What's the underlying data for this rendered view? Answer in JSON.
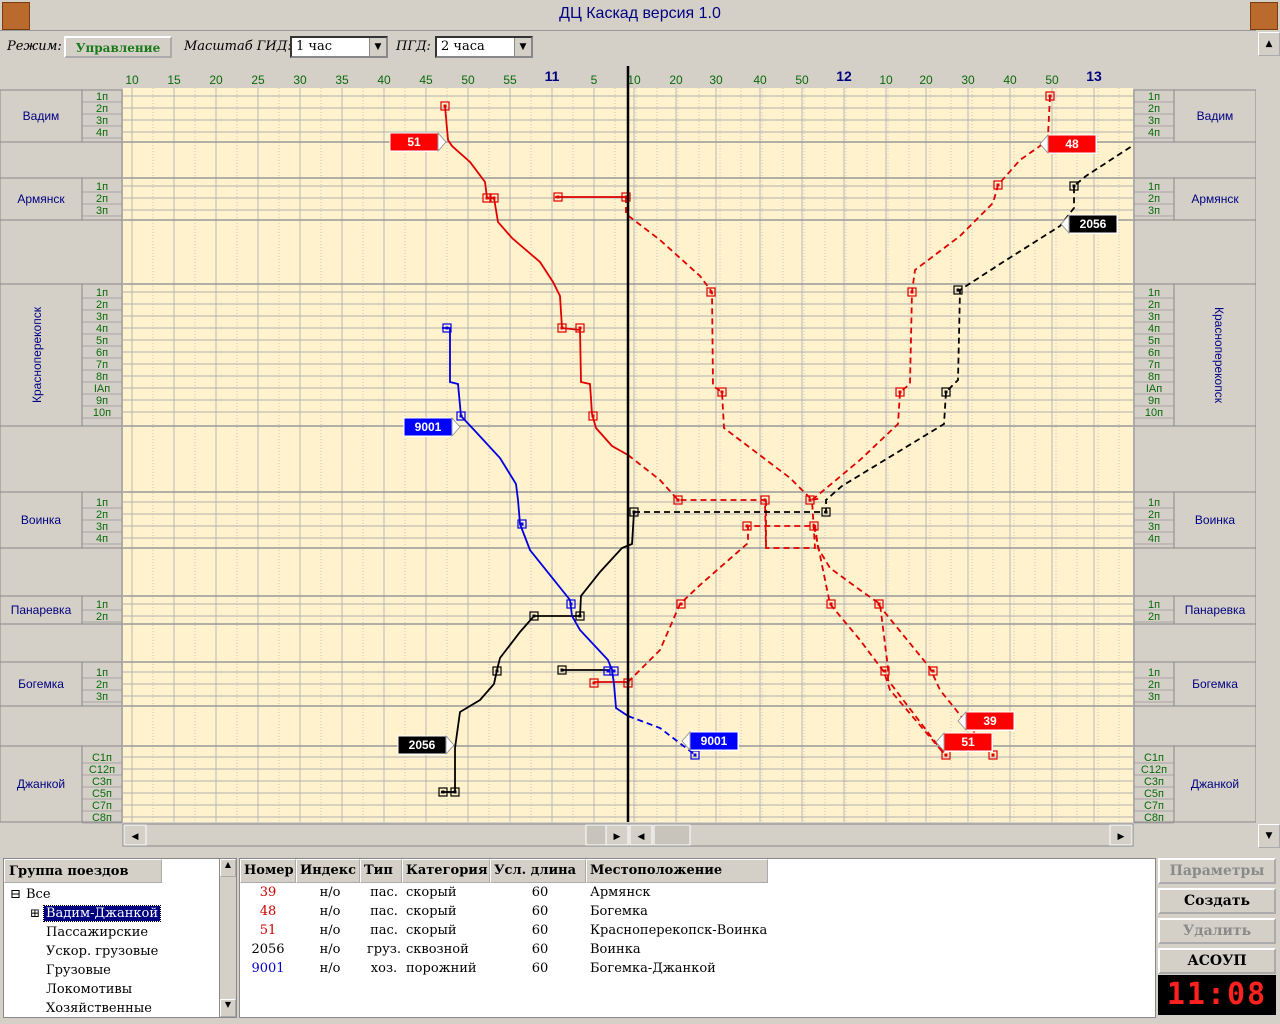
{
  "window": {
    "title": "ДЦ Каскад версия 1.0"
  },
  "toolbar": {
    "mode_label": "Режим:",
    "mode_value": "Управление",
    "scale_label": "Масштаб ГИД:",
    "scale_value": "1 час",
    "pgd_label": "ПГД:",
    "pgd_value": "2 часа"
  },
  "timeline": {
    "ticks": [
      "10",
      "15",
      "20",
      "25",
      "30",
      "35",
      "40",
      "45",
      "50",
      "55",
      "11",
      "5",
      "10",
      "20",
      "30",
      "40",
      "50",
      "12",
      "10",
      "20",
      "30",
      "40",
      "50",
      "13"
    ]
  },
  "stations": [
    {
      "name": "Вадим",
      "tracks": [
        "1п",
        "2п",
        "3п",
        "4п"
      ],
      "orientation": "horizontal"
    },
    {
      "name": "Армянск",
      "tracks": [
        "1п",
        "2п",
        "3п"
      ],
      "orientation": "horizontal"
    },
    {
      "name": "Красноперекопск",
      "tracks": [
        "1п",
        "2п",
        "3п",
        "4п",
        "5п",
        "6п",
        "7п",
        "8п",
        "IАп",
        "9п",
        "10п"
      ],
      "orientation": "vertical"
    },
    {
      "name": "Воинка",
      "tracks": [
        "1п",
        "2п",
        "3п",
        "4п"
      ],
      "orientation": "horizontal"
    },
    {
      "name": "Панаревка",
      "tracks": [
        "1п",
        "2п"
      ],
      "orientation": "horizontal"
    },
    {
      "name": "Богемка",
      "tracks": [
        "1п",
        "2п",
        "3п"
      ],
      "orientation": "horizontal"
    },
    {
      "name": "Джанкой",
      "tracks": [
        "С1п",
        "С12п",
        "С3п",
        "С5п",
        "С7п",
        "С8п"
      ],
      "orientation": "horizontal"
    }
  ],
  "train_labels": [
    {
      "number": "51",
      "color": "#ff0000"
    },
    {
      "number": "48",
      "color": "#ff0000"
    },
    {
      "number": "2056",
      "color": "#000000"
    },
    {
      "number": "9001",
      "color": "#0000ff"
    },
    {
      "number": "9001",
      "color": "#0000ff"
    },
    {
      "number": "2056",
      "color": "#000000"
    },
    {
      "number": "39",
      "color": "#ff0000"
    },
    {
      "number": "51",
      "color": "#ff0000"
    }
  ],
  "tree": {
    "header": "Группа поездов",
    "items": [
      "Все",
      "Вадим-Джанкой",
      "Пассажирские",
      "Ускор. грузовые",
      "Грузовые",
      "Локомотивы",
      "Хозяйственные"
    ],
    "expand_root": "⊟",
    "expand_child": "⊞"
  },
  "table": {
    "columns": [
      "Номер",
      "Индекс",
      "Тип",
      "Категория",
      "Усл. длина",
      "Местоположение"
    ],
    "rows": [
      {
        "number": "39",
        "index": "н/о",
        "type": "пас.",
        "category": "скорый",
        "length": "60",
        "location": "Армянск",
        "color": "#cc0000"
      },
      {
        "number": "48",
        "index": "н/о",
        "type": "пас.",
        "category": "скорый",
        "length": "60",
        "location": "Богемка",
        "color": "#cc0000"
      },
      {
        "number": "51",
        "index": "н/о",
        "type": "пас.",
        "category": "скорый",
        "length": "60",
        "location": "Красноперекопск-Воинка",
        "color": "#cc0000"
      },
      {
        "number": "2056",
        "index": "н/о",
        "type": "груз.",
        "category": "сквозной",
        "length": "60",
        "location": "Воинка",
        "color": "#000000"
      },
      {
        "number": "9001",
        "index": "н/о",
        "type": "хоз.",
        "category": "порожний",
        "length": "60",
        "location": "Богемка-Джанкой",
        "color": "#0000cc"
      }
    ]
  },
  "buttons": {
    "params": "Параметры",
    "create": "Создать",
    "delete": "Удалить",
    "asoup": "АСОУП"
  },
  "clock": "11:08"
}
